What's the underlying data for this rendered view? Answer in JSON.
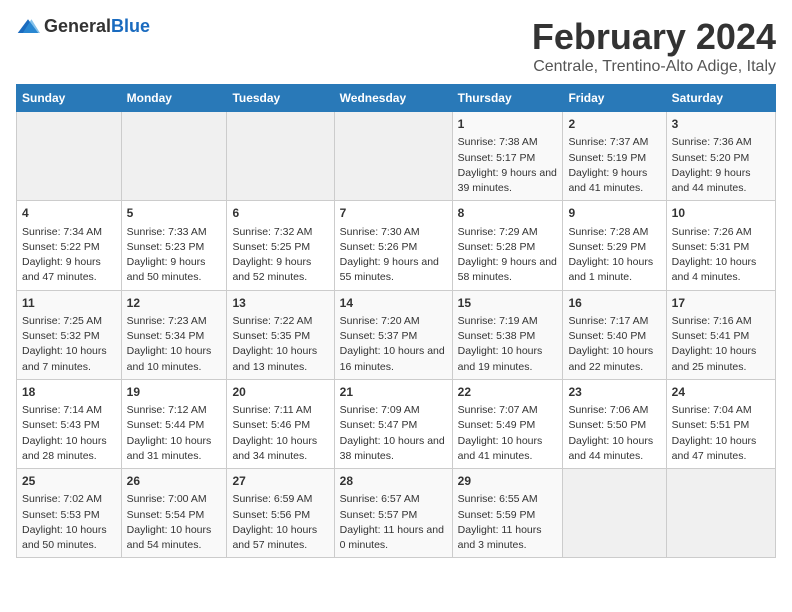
{
  "logo": {
    "general": "General",
    "blue": "Blue"
  },
  "title": "February 2024",
  "subtitle": "Centrale, Trentino-Alto Adige, Italy",
  "days_of_week": [
    "Sunday",
    "Monday",
    "Tuesday",
    "Wednesday",
    "Thursday",
    "Friday",
    "Saturday"
  ],
  "weeks": [
    [
      {
        "day": "",
        "info": ""
      },
      {
        "day": "",
        "info": ""
      },
      {
        "day": "",
        "info": ""
      },
      {
        "day": "",
        "info": ""
      },
      {
        "day": "1",
        "info": "Sunrise: 7:38 AM\nSunset: 5:17 PM\nDaylight: 9 hours and 39 minutes."
      },
      {
        "day": "2",
        "info": "Sunrise: 7:37 AM\nSunset: 5:19 PM\nDaylight: 9 hours and 41 minutes."
      },
      {
        "day": "3",
        "info": "Sunrise: 7:36 AM\nSunset: 5:20 PM\nDaylight: 9 hours and 44 minutes."
      }
    ],
    [
      {
        "day": "4",
        "info": "Sunrise: 7:34 AM\nSunset: 5:22 PM\nDaylight: 9 hours and 47 minutes."
      },
      {
        "day": "5",
        "info": "Sunrise: 7:33 AM\nSunset: 5:23 PM\nDaylight: 9 hours and 50 minutes."
      },
      {
        "day": "6",
        "info": "Sunrise: 7:32 AM\nSunset: 5:25 PM\nDaylight: 9 hours and 52 minutes."
      },
      {
        "day": "7",
        "info": "Sunrise: 7:30 AM\nSunset: 5:26 PM\nDaylight: 9 hours and 55 minutes."
      },
      {
        "day": "8",
        "info": "Sunrise: 7:29 AM\nSunset: 5:28 PM\nDaylight: 9 hours and 58 minutes."
      },
      {
        "day": "9",
        "info": "Sunrise: 7:28 AM\nSunset: 5:29 PM\nDaylight: 10 hours and 1 minute."
      },
      {
        "day": "10",
        "info": "Sunrise: 7:26 AM\nSunset: 5:31 PM\nDaylight: 10 hours and 4 minutes."
      }
    ],
    [
      {
        "day": "11",
        "info": "Sunrise: 7:25 AM\nSunset: 5:32 PM\nDaylight: 10 hours and 7 minutes."
      },
      {
        "day": "12",
        "info": "Sunrise: 7:23 AM\nSunset: 5:34 PM\nDaylight: 10 hours and 10 minutes."
      },
      {
        "day": "13",
        "info": "Sunrise: 7:22 AM\nSunset: 5:35 PM\nDaylight: 10 hours and 13 minutes."
      },
      {
        "day": "14",
        "info": "Sunrise: 7:20 AM\nSunset: 5:37 PM\nDaylight: 10 hours and 16 minutes."
      },
      {
        "day": "15",
        "info": "Sunrise: 7:19 AM\nSunset: 5:38 PM\nDaylight: 10 hours and 19 minutes."
      },
      {
        "day": "16",
        "info": "Sunrise: 7:17 AM\nSunset: 5:40 PM\nDaylight: 10 hours and 22 minutes."
      },
      {
        "day": "17",
        "info": "Sunrise: 7:16 AM\nSunset: 5:41 PM\nDaylight: 10 hours and 25 minutes."
      }
    ],
    [
      {
        "day": "18",
        "info": "Sunrise: 7:14 AM\nSunset: 5:43 PM\nDaylight: 10 hours and 28 minutes."
      },
      {
        "day": "19",
        "info": "Sunrise: 7:12 AM\nSunset: 5:44 PM\nDaylight: 10 hours and 31 minutes."
      },
      {
        "day": "20",
        "info": "Sunrise: 7:11 AM\nSunset: 5:46 PM\nDaylight: 10 hours and 34 minutes."
      },
      {
        "day": "21",
        "info": "Sunrise: 7:09 AM\nSunset: 5:47 PM\nDaylight: 10 hours and 38 minutes."
      },
      {
        "day": "22",
        "info": "Sunrise: 7:07 AM\nSunset: 5:49 PM\nDaylight: 10 hours and 41 minutes."
      },
      {
        "day": "23",
        "info": "Sunrise: 7:06 AM\nSunset: 5:50 PM\nDaylight: 10 hours and 44 minutes."
      },
      {
        "day": "24",
        "info": "Sunrise: 7:04 AM\nSunset: 5:51 PM\nDaylight: 10 hours and 47 minutes."
      }
    ],
    [
      {
        "day": "25",
        "info": "Sunrise: 7:02 AM\nSunset: 5:53 PM\nDaylight: 10 hours and 50 minutes."
      },
      {
        "day": "26",
        "info": "Sunrise: 7:00 AM\nSunset: 5:54 PM\nDaylight: 10 hours and 54 minutes."
      },
      {
        "day": "27",
        "info": "Sunrise: 6:59 AM\nSunset: 5:56 PM\nDaylight: 10 hours and 57 minutes."
      },
      {
        "day": "28",
        "info": "Sunrise: 6:57 AM\nSunset: 5:57 PM\nDaylight: 11 hours and 0 minutes."
      },
      {
        "day": "29",
        "info": "Sunrise: 6:55 AM\nSunset: 5:59 PM\nDaylight: 11 hours and 3 minutes."
      },
      {
        "day": "",
        "info": ""
      },
      {
        "day": "",
        "info": ""
      }
    ]
  ]
}
